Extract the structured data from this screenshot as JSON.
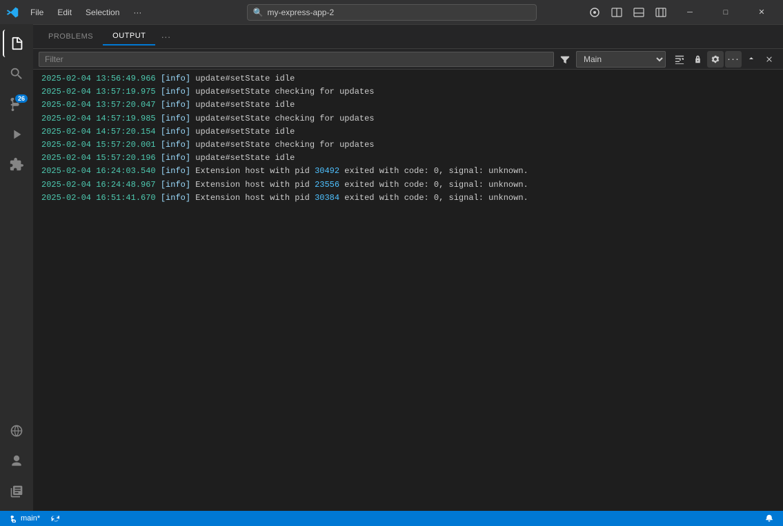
{
  "titlebar": {
    "menu_items": [
      "File",
      "Edit",
      "Selection",
      "···"
    ],
    "search_placeholder": "my-express-app-2",
    "search_icon": "🔍",
    "ai_badge": "✦",
    "win_minimize": "─",
    "win_maximize": "□",
    "win_close": "✕"
  },
  "activitybar": {
    "icons": [
      {
        "name": "explorer-icon",
        "symbol": "📄",
        "active": true
      },
      {
        "name": "search-icon",
        "symbol": "🔍",
        "active": false
      },
      {
        "name": "source-control-icon",
        "symbol": "⑂",
        "active": false,
        "badge": "26"
      },
      {
        "name": "run-debug-icon",
        "symbol": "▷",
        "active": false
      },
      {
        "name": "extensions-icon",
        "symbol": "⊞",
        "active": false
      }
    ],
    "bottom_icons": [
      {
        "name": "remote-icon",
        "symbol": "⊙"
      },
      {
        "name": "account-icon",
        "symbol": "👤"
      },
      {
        "name": "library-icon",
        "symbol": "≡"
      }
    ]
  },
  "panel": {
    "tabs": [
      {
        "label": "PROBLEMS",
        "active": false
      },
      {
        "label": "OUTPUT",
        "active": true
      }
    ],
    "more_label": "···",
    "filter_placeholder": "Filter",
    "source_label": "Main",
    "toolbar_icons": [
      {
        "name": "filter-icon",
        "symbol": "⊽"
      },
      {
        "name": "wrap-icon",
        "symbol": "≡"
      },
      {
        "name": "lock-icon",
        "symbol": "🔒"
      },
      {
        "name": "settings-icon",
        "symbol": "⚙"
      },
      {
        "name": "more-icon",
        "symbol": "···"
      },
      {
        "name": "expand-icon",
        "symbol": "∧"
      },
      {
        "name": "close-icon",
        "symbol": "✕"
      }
    ]
  },
  "output_lines": [
    {
      "timestamp": "2025-02-04 13:56:49.966",
      "level": "[info]",
      "message": "update#setState idle",
      "pids": []
    },
    {
      "timestamp": "2025-02-04 13:57:19.975",
      "level": "[info]",
      "message": "update#setState checking for updates",
      "pids": []
    },
    {
      "timestamp": "2025-02-04 13:57:20.047",
      "level": "[info]",
      "message": "update#setState idle",
      "pids": []
    },
    {
      "timestamp": "2025-02-04 14:57:19.985",
      "level": "[info]",
      "message": "update#setState checking for updates",
      "pids": []
    },
    {
      "timestamp": "2025-02-04 14:57:20.154",
      "level": "[info]",
      "message": "update#setState idle",
      "pids": []
    },
    {
      "timestamp": "2025-02-04 15:57:20.001",
      "level": "[info]",
      "message": "update#setState checking for updates",
      "pids": []
    },
    {
      "timestamp": "2025-02-04 15:57:20.196",
      "level": "[info]",
      "message": "update#setState idle",
      "pids": []
    },
    {
      "timestamp": "2025-02-04 16:24:03.540",
      "level": "[info]",
      "message": "Extension host with pid ",
      "pid_value": "30492",
      "message_after": " exited with code: 0, signal: unknown."
    },
    {
      "timestamp": "2025-02-04 16:24:48.967",
      "level": "[info]",
      "message": "Extension host with pid ",
      "pid_value": "23556",
      "message_after": " exited with code: 0, signal: unknown."
    },
    {
      "timestamp": "2025-02-04 16:51:41.670",
      "level": "[info]",
      "message": "Extension host with pid ",
      "pid_value": "30384",
      "message_after": " exited with code: 0, signal: unknown."
    }
  ],
  "statusbar": {
    "branch_icon": "⎇",
    "branch_name": "main*",
    "sync_icon": "↻",
    "bell_icon": "🔔",
    "right_text": ""
  },
  "colors": {
    "accent": "#0078d4",
    "bg_dark": "#1e1e1e",
    "bg_panel": "#252526",
    "text_green": "#4ec9b0",
    "text_blue": "#4fc1ff",
    "text_main": "#cccccc"
  }
}
